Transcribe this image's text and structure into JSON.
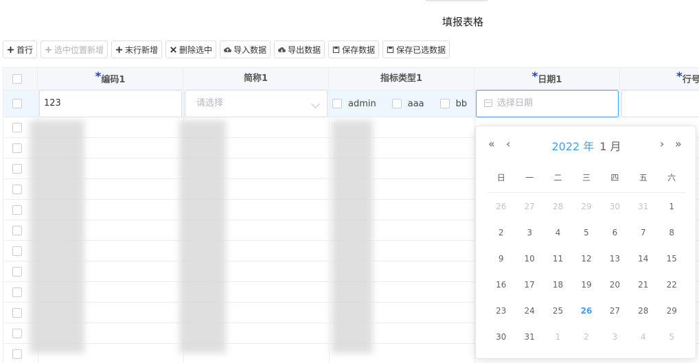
{
  "page": {
    "title": "填报表格"
  },
  "toolbar": {
    "buttons": [
      {
        "label": "首行",
        "icon": "plus-icon",
        "disabled": false
      },
      {
        "label": "选中位置新增",
        "icon": "plus-icon",
        "disabled": true
      },
      {
        "label": "末行新增",
        "icon": "plus-icon",
        "disabled": false
      },
      {
        "label": "删除选中",
        "icon": "close-icon",
        "disabled": false
      },
      {
        "label": "导入数据",
        "icon": "cloud-upload-icon",
        "disabled": false
      },
      {
        "label": "导出数据",
        "icon": "cloud-download-icon",
        "disabled": false
      },
      {
        "label": "保存数据",
        "icon": "save-icon",
        "disabled": false
      },
      {
        "label": "保存已选数据",
        "icon": "save-icon",
        "disabled": false
      }
    ]
  },
  "table": {
    "required_mark": "*",
    "columns": [
      {
        "label": "编码1",
        "required": true
      },
      {
        "label": "简称1",
        "required": false
      },
      {
        "label": "指标类型1",
        "required": false
      },
      {
        "label": "日期1",
        "required": true
      },
      {
        "label": "行号",
        "required": true
      }
    ],
    "edit_row": {
      "code_value": "123",
      "abbr_placeholder": "请选择",
      "type_options": [
        "admin",
        "aaa",
        "bb"
      ],
      "date_placeholder": "选择日期"
    }
  },
  "date_picker": {
    "year": "2022 年",
    "month": "1 月",
    "weekdays": [
      "日",
      "一",
      "二",
      "三",
      "四",
      "五",
      "六"
    ],
    "weeks": [
      [
        {
          "d": "26",
          "o": true
        },
        {
          "d": "27",
          "o": true
        },
        {
          "d": "28",
          "o": true
        },
        {
          "d": "29",
          "o": true
        },
        {
          "d": "30",
          "o": true
        },
        {
          "d": "31",
          "o": true
        },
        {
          "d": "1"
        }
      ],
      [
        {
          "d": "2"
        },
        {
          "d": "3"
        },
        {
          "d": "4"
        },
        {
          "d": "5"
        },
        {
          "d": "6"
        },
        {
          "d": "7"
        },
        {
          "d": "8"
        }
      ],
      [
        {
          "d": "9"
        },
        {
          "d": "10"
        },
        {
          "d": "11"
        },
        {
          "d": "12"
        },
        {
          "d": "13"
        },
        {
          "d": "14"
        },
        {
          "d": "15"
        }
      ],
      [
        {
          "d": "16"
        },
        {
          "d": "17"
        },
        {
          "d": "18"
        },
        {
          "d": "19"
        },
        {
          "d": "20"
        },
        {
          "d": "21"
        },
        {
          "d": "22"
        }
      ],
      [
        {
          "d": "23"
        },
        {
          "d": "24"
        },
        {
          "d": "25"
        },
        {
          "d": "26",
          "today": true
        },
        {
          "d": "27"
        },
        {
          "d": "28"
        },
        {
          "d": "29"
        }
      ],
      [
        {
          "d": "30"
        },
        {
          "d": "31"
        },
        {
          "d": "1",
          "o": true
        },
        {
          "d": "2",
          "o": true
        },
        {
          "d": "3",
          "o": true
        },
        {
          "d": "4",
          "o": true
        },
        {
          "d": "5",
          "o": true
        }
      ]
    ],
    "highlight_color": "#409eff"
  }
}
